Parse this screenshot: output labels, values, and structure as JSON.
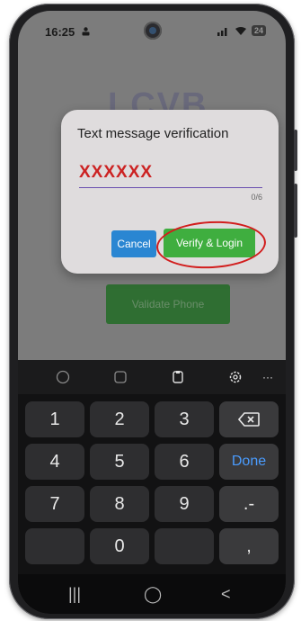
{
  "status_bar": {
    "time": "16:25",
    "battery": "24"
  },
  "app": {
    "logo_text": "LCVB",
    "validate_label": "Validate Phone"
  },
  "dialog": {
    "title": "Text message verification",
    "code_value": "XXXXXX",
    "counter": "0/6",
    "cancel_label": "Cancel",
    "verify_label": "Verify & Login"
  },
  "keyboard": {
    "toolbar_icons": [
      "emoji-icon",
      "stickers-icon",
      "clipboard-icon",
      "settings-icon",
      "more-icon"
    ],
    "keys": {
      "k1": "1",
      "k2": "2",
      "k3": "3",
      "k4": "4",
      "k5": "5",
      "k6": "6",
      "k7": "7",
      "k8": "8",
      "k9": "9",
      "k0": "0",
      "done": "Done",
      "dot_dash": ".-",
      "comma": ","
    }
  },
  "nav_bar": {
    "recents": "|||",
    "home": "◯",
    "back": "<"
  },
  "colors": {
    "accent_red": "#d21d1d",
    "verify_green": "#3fae3f",
    "cancel_blue": "#2a86d2",
    "done_blue": "#4a9cff"
  }
}
